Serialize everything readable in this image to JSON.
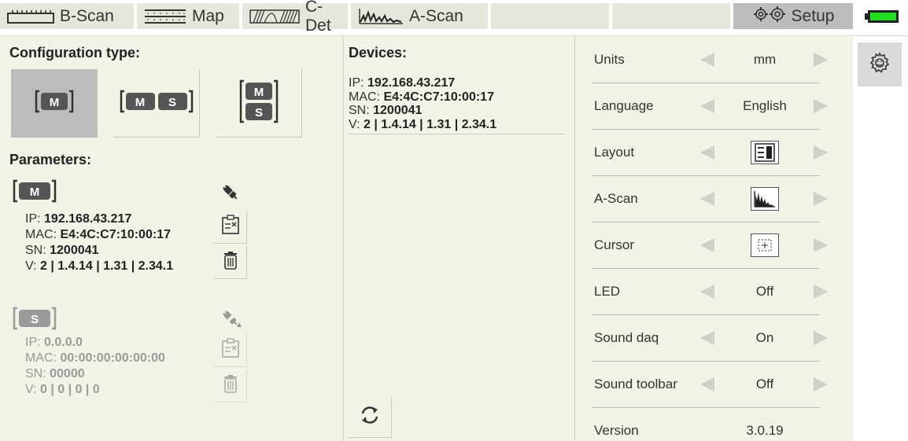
{
  "tabs": [
    {
      "label": "B-Scan",
      "icon": "bscan-icon"
    },
    {
      "label": "Map",
      "icon": "map-grid-icon"
    },
    {
      "label": "C-Det",
      "icon": "cdet-icon"
    },
    {
      "label": "A-Scan",
      "icon": "ascan-icon"
    }
  ],
  "setup_tab": {
    "label": "Setup",
    "icon": "gears-icon"
  },
  "battery": {
    "level": 1.0,
    "color": "#22dd22"
  },
  "config": {
    "title": "Configuration type:",
    "options": [
      {
        "id": "M",
        "labels": [
          "M"
        ],
        "selected": true
      },
      {
        "id": "MS",
        "labels": [
          "M",
          "S"
        ],
        "selected": false
      },
      {
        "id": "M_over_S",
        "labels": [
          "M",
          "S"
        ],
        "selected": false
      }
    ]
  },
  "parameters": {
    "title": "Parameters:",
    "master": {
      "tag": "M",
      "ip_label": "IP:",
      "ip": "192.168.43.217",
      "mac_label": "MAC:",
      "mac": "E4:4C:C7:10:00:17",
      "sn_label": "SN:",
      "sn": "1200041",
      "v_label": "V:",
      "v_main": "2",
      "v_rest": " | 1.4.14 | 1.31 | 2.34.1"
    },
    "slave": {
      "tag": "S",
      "ip_label": "IP:",
      "ip": "0.0.0.0",
      "mac_label": "MAC:",
      "mac": "00:00:00:00:00:00",
      "sn_label": "SN:",
      "sn": "00000",
      "v_label": "V:",
      "v_main": "0",
      "v_rest": " | 0 | 0 | 0"
    }
  },
  "devices": {
    "title": "Devices:",
    "items": [
      {
        "ip_label": "IP:",
        "ip": "192.168.43.217",
        "mac_label": "MAC:",
        "mac": "E4:4C:C7:10:00:17",
        "sn_label": "SN:",
        "sn": "1200041",
        "v_label": "V:",
        "v": "2 | 1.4.14 | 1.31 | 2.34.1"
      }
    ]
  },
  "settings": [
    {
      "label": "Units",
      "value": "mm",
      "kind": "text"
    },
    {
      "label": "Language",
      "value": "English",
      "kind": "text"
    },
    {
      "label": "Layout",
      "value": "",
      "kind": "layout-icon"
    },
    {
      "label": "A-Scan",
      "value": "",
      "kind": "ascan-icon"
    },
    {
      "label": "Cursor",
      "value": "",
      "kind": "cursor-icon"
    },
    {
      "label": "LED",
      "value": "Off",
      "kind": "text"
    },
    {
      "label": "Sound daq",
      "value": "On",
      "kind": "text"
    },
    {
      "label": "Sound toolbar",
      "value": "Off",
      "kind": "text"
    },
    {
      "label": "Version",
      "value": "3.0.19",
      "kind": "static"
    }
  ]
}
